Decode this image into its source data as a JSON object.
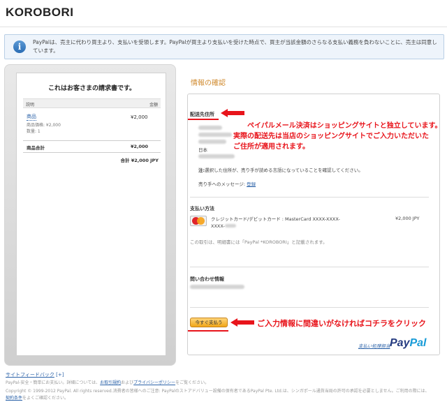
{
  "header": {
    "store_name": "KOROBORI"
  },
  "notice": {
    "icon": "info-icon",
    "text": "PayPalは、売主に代わり買主より、支払いを受領します。PayPalが買主より支払いを受けた時点で、買主が当該金額のさらなる支払い義務を負わないことに、売主は同意しています。"
  },
  "invoice": {
    "title": "これはお客さまの請求書です。",
    "col_description": "説明",
    "col_amount": "金額",
    "item_name": "商品",
    "item_price": "¥2,000",
    "item_unit_price": "商品価格: ¥2,000",
    "item_quantity": "数量: 1",
    "subtotal_label": "商品合計",
    "subtotal_value": "¥2,000",
    "total": "合計 ¥2,000 JPY"
  },
  "review": {
    "heading": "情報の確認",
    "shipping_label": "配送先住所",
    "address_country": "日本",
    "address_note_label": "注:",
    "address_note": "選択した住所が、売り手が読める言語になっていることを確認してください。",
    "seller_message_label": "売り手へのメッセージ:",
    "seller_message_link": "登録",
    "payment_label": "支払い方法",
    "card_text_line1": "クレジットカード/デビットカード : MasterCard XXXX-XXXX-",
    "card_text_line2": "XXXX-",
    "card_amount": "¥2,000 JPY",
    "card_logo_icon": "mastercard-icon",
    "statement_note": "この取引は、明細書には「PayPal *KOROBORI」と記載されます。",
    "contact_label": "問い合わせ情報",
    "pay_button": "今すぐ支払う",
    "secure_link": "支払い処理担当",
    "paypal_logo_pay": "Pay",
    "paypal_logo_pal": "Pal"
  },
  "annotations": {
    "line1": "ペイパルメール決済はショッピングサイトと独立しています。",
    "line2": "実際の配送先は当店のショッピングサイトでご入力いただいた",
    "line3": "ご住所が適用されます。",
    "bottom": "ご入力情報に間違いがなければコチラをクリック",
    "color": "#e8141b"
  },
  "footer": {
    "feedback_link": "サイトフィードバック",
    "feedback_bracket": "[+]",
    "line1_pre": "PayPal-安全・簡単にお支払い。詳細については、",
    "line1_link1": "お取引規約",
    "line1_mid": "および",
    "line1_link2": "プライバシーポリシー",
    "line1_post": "をご覧ください。",
    "line2": "Copyright © 1999-2012 PayPal. All rights reserved.消費者の皆様へのご注意: PayPalのストアドバリュー設備の保有者であるPayPal Pte. Ltd.は、シンガポール通貨当局の許可の承認を必要としません。ご利用の際には、",
    "line3_link": "契約条件",
    "line3_post": "をよくご確認ください。"
  },
  "colors": {
    "accent_orange": "#d08a2e",
    "link_blue": "#2b62a8",
    "annotation_red": "#e8141b"
  }
}
